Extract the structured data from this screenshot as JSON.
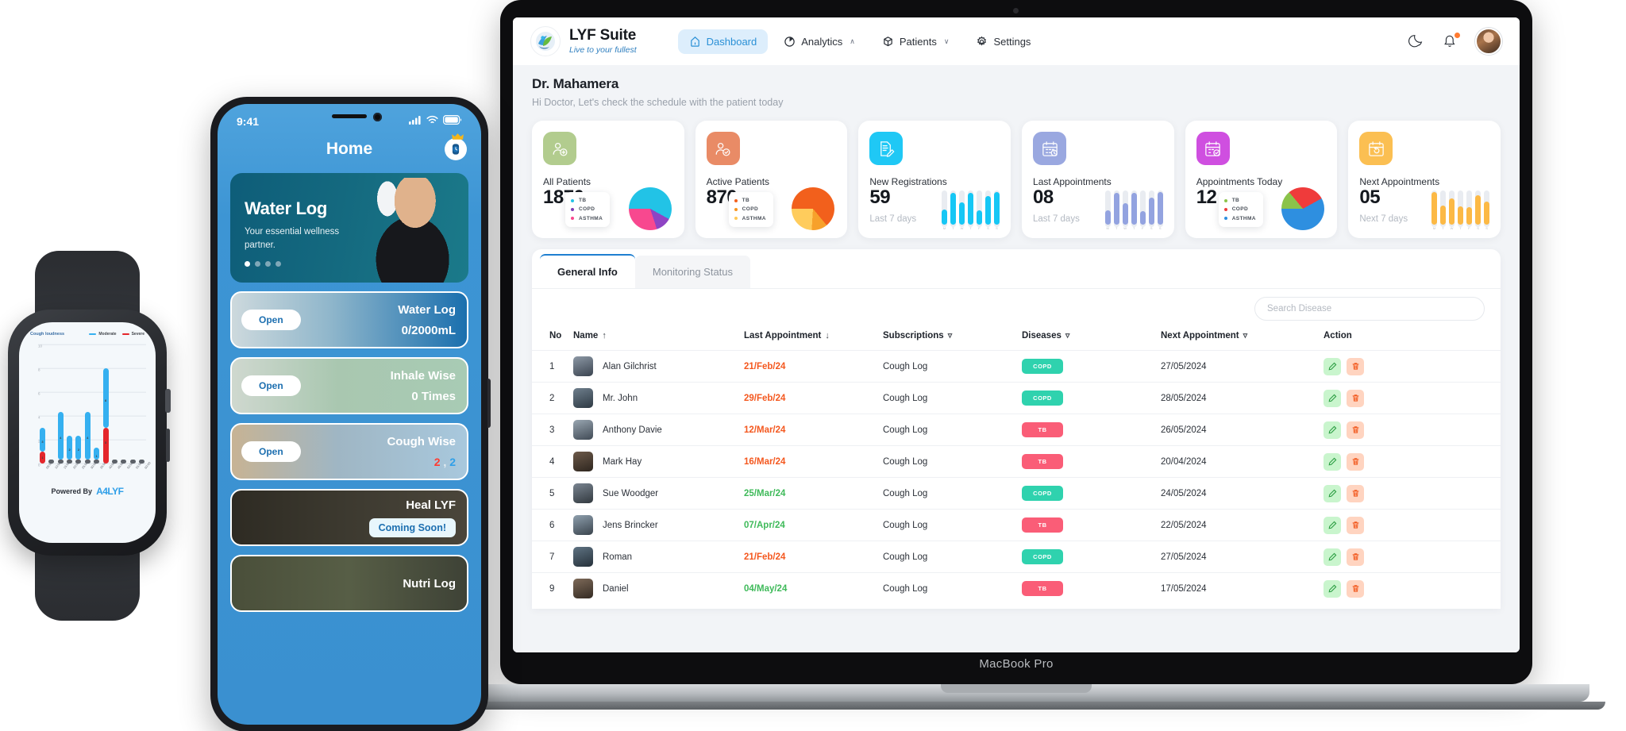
{
  "macbook": {
    "label": "MacBook Pro"
  },
  "dashboard": {
    "brand": {
      "title": "LYF Suite",
      "tagline": "Live to your fullest",
      "logo_icon": "lyf-heart-leaf-logo"
    },
    "nav": [
      {
        "label": "Dashboard",
        "icon": "home-icon",
        "active": true,
        "chevron": ""
      },
      {
        "label": "Analytics",
        "icon": "pie-chart-icon",
        "active": false,
        "chevron": "∧"
      },
      {
        "label": "Patients",
        "icon": "box-icon",
        "active": false,
        "chevron": "∨"
      },
      {
        "label": "Settings",
        "icon": "gear-icon",
        "active": false,
        "chevron": ""
      }
    ],
    "topright": {
      "theme_icon": "moon-icon",
      "notifications_icon": "bell-icon",
      "avatar_icon": "user-avatar"
    },
    "greeting": {
      "name": "Dr. Mahamera",
      "subtitle": "Hi Doctor, Let's check the schedule with the patient today"
    },
    "cards": [
      {
        "title": "All Patients",
        "value": "1870",
        "sub": "",
        "icon": "patient-add-icon",
        "icon_bg": "#b2cc8e",
        "chart": "pie",
        "legend": [
          {
            "label": "TB",
            "color": "#22c3e6"
          },
          {
            "label": "COPD",
            "color": "#7c3fb5"
          },
          {
            "label": "ASTHMA",
            "color": "#f8488f"
          }
        ],
        "pie_slices": [
          {
            "label": "TB",
            "value": 58,
            "color": "#22c3e6"
          },
          {
            "label": "COPD",
            "value": 12,
            "color": "#8e44c4"
          },
          {
            "label": "ASTHMA",
            "value": 30,
            "color": "#f8488f"
          }
        ]
      },
      {
        "title": "Active Patients",
        "value": "870",
        "sub": "",
        "icon": "patient-check-icon",
        "icon_bg": "#e98b66",
        "chart": "pie",
        "legend": [
          {
            "label": "TB",
            "color": "#f2601c"
          },
          {
            "label": "COPD",
            "color": "#f7941e"
          },
          {
            "label": "ASTHMA",
            "color": "#ffc857"
          }
        ],
        "pie_slices": [
          {
            "label": "TB",
            "value": 64,
            "color": "#f2601c"
          },
          {
            "label": "COPD",
            "value": 12,
            "color": "#f7a12b"
          },
          {
            "label": "ASTHMA",
            "value": 24,
            "color": "#ffcc5c"
          }
        ]
      },
      {
        "title": "New Registrations",
        "value": "59",
        "sub": "Last 7 days",
        "icon": "document-edit-icon",
        "icon_bg": "#1fc8f5",
        "chart": "bars",
        "bar_color": "#16c7f5",
        "bars": {
          "days": [
            "M",
            "T",
            "W",
            "T",
            "F",
            "S",
            "S"
          ],
          "values": [
            42,
            88,
            60,
            86,
            40,
            78,
            90
          ]
        }
      },
      {
        "title": "Last Appointments",
        "value": "08",
        "sub": "Last 7 days",
        "icon": "calendar-clock-icon",
        "icon_bg": "#9aa8e0",
        "chart": "bars",
        "bar_color": "#93a3e0",
        "bars": {
          "days": [
            "M",
            "T",
            "W",
            "T",
            "F",
            "S",
            "S"
          ],
          "values": [
            40,
            86,
            58,
            88,
            38,
            74,
            90
          ]
        }
      },
      {
        "title": "Appointments Today",
        "value": "12",
        "sub": "",
        "icon": "calendar-check-icon",
        "icon_bg": "#cf4fe0",
        "chart": "pie",
        "legend": [
          {
            "label": "TB",
            "color": "#8bc34a"
          },
          {
            "label": "COPD",
            "color": "#ef3b3b"
          },
          {
            "label": "ASTHMA",
            "color": "#2e8fe0"
          }
        ],
        "pie_slices": [
          {
            "label": "TB",
            "value": 14,
            "color": "#8bc34a"
          },
          {
            "label": "COPD",
            "value": 28,
            "color": "#ef3b3b"
          },
          {
            "label": "ASTHMA",
            "value": 58,
            "color": "#2e8fe0"
          }
        ]
      },
      {
        "title": "Next Appointments",
        "value": "05",
        "sub": "Next 7 days",
        "icon": "calendar-next-icon",
        "icon_bg": "#fbbf52",
        "chart": "bars",
        "bar_color": "#fcb945",
        "bars": {
          "days": [
            "M",
            "T",
            "W",
            "T",
            "F",
            "S",
            "S"
          ],
          "values": [
            90,
            52,
            72,
            50,
            48,
            80,
            62
          ]
        }
      }
    ],
    "tabs": [
      {
        "label": "General Info",
        "active": true
      },
      {
        "label": "Monitoring Status",
        "active": false
      }
    ],
    "search": {
      "placeholder": "Search Disease",
      "value": ""
    },
    "table": {
      "columns": [
        {
          "label": "No",
          "sort": ""
        },
        {
          "label": "Name",
          "sort": "↑"
        },
        {
          "label": "Last Appointment",
          "sort": "↓"
        },
        {
          "label": "Subscriptions",
          "sort": "filter"
        },
        {
          "label": "Diseases",
          "sort": "filter"
        },
        {
          "label": "Next Appointment",
          "sort": "filter"
        },
        {
          "label": "Action",
          "sort": ""
        }
      ],
      "rows": [
        {
          "no": "1",
          "name": "Alan Gilchrist",
          "last": "21/Feb/24",
          "last_state": "overdue",
          "subs": "Cough Log",
          "disease": "COPD",
          "next": "27/05/2024"
        },
        {
          "no": "2",
          "name": "Mr. John",
          "last": "29/Feb/24",
          "last_state": "overdue",
          "subs": "Cough Log",
          "disease": "COPD",
          "next": "28/05/2024"
        },
        {
          "no": "3",
          "name": "Anthony Davie",
          "last": "12/Mar/24",
          "last_state": "overdue",
          "subs": "Cough Log",
          "disease": "TB",
          "next": "26/05/2024"
        },
        {
          "no": "4",
          "name": "Mark Hay",
          "last": "16/Mar/24",
          "last_state": "overdue",
          "subs": "Cough Log",
          "disease": "TB",
          "next": "20/04/2024"
        },
        {
          "no": "5",
          "name": "Sue Woodger",
          "last": "25/Mar/24",
          "last_state": "ok",
          "subs": "Cough Log",
          "disease": "COPD",
          "next": "24/05/2024"
        },
        {
          "no": "6",
          "name": "Jens Brincker",
          "last": "07/Apr/24",
          "last_state": "ok",
          "subs": "Cough Log",
          "disease": "TB",
          "next": "22/05/2024"
        },
        {
          "no": "7",
          "name": "Roman",
          "last": "21/Feb/24",
          "last_state": "overdue",
          "subs": "Cough Log",
          "disease": "COPD",
          "next": "27/05/2024"
        },
        {
          "no": "9",
          "name": "Daniel",
          "last": "04/May/24",
          "last_state": "ok",
          "subs": "Cough Log",
          "disease": "TB",
          "next": "17/05/2024"
        }
      ],
      "actions": {
        "edit_icon": "pencil-icon",
        "delete_icon": "trash-icon"
      }
    }
  },
  "phone": {
    "status": {
      "time": "9:41",
      "signal_icon": "cellular-signal-icon",
      "wifi_icon": "wifi-icon",
      "battery_icon": "battery-icon"
    },
    "header": {
      "title": "Home",
      "watch_icon": "smartwatch-premium-icon",
      "crown_icon": "crown-icon"
    },
    "hero": {
      "title": "Water Log",
      "subtitle": "Your essential wellness partner.",
      "dots": 4,
      "active_dot": 0
    },
    "tiles": [
      {
        "title": "Water Log",
        "value": "0/2000mL",
        "open_label": "Open",
        "style": "wl"
      },
      {
        "title": "Inhale Wise",
        "value": "0 Times",
        "open_label": "Open",
        "style": "iw"
      },
      {
        "title": "Cough Wise",
        "value": "2 , 2",
        "open_label": "Open",
        "style": "cw"
      },
      {
        "title": "Heal LYF",
        "badge": "Coming Soon!",
        "style": "hl"
      },
      {
        "title": "Nutri Log",
        "style": "nl"
      }
    ]
  },
  "watch": {
    "powered_by": "Powered By",
    "brand": "A4LYF",
    "chart_data": {
      "type": "bar",
      "title": "Cough loudness",
      "xlabel": "",
      "ylabel": "",
      "ylim": [
        0,
        10
      ],
      "yticks": [
        0,
        2,
        4,
        6,
        8,
        10
      ],
      "grid": true,
      "legend_position": "top-right",
      "categories": [
        "08:00",
        "10:00",
        "15:00",
        "20:00",
        "25:00",
        "30:00",
        "35:00",
        "40:00",
        "45:00",
        "50:00",
        "55:00",
        "60:00"
      ],
      "series": [
        {
          "name": "Moderate",
          "color": "#35b0f0",
          "values": [
            3,
            0,
            4,
            2,
            2,
            4,
            1,
            8,
            0,
            0,
            0,
            0
          ]
        },
        {
          "name": "Severe",
          "color": "#e4262b",
          "values": [
            1,
            0,
            0,
            0,
            0,
            0,
            0,
            3,
            0,
            0,
            0,
            0
          ]
        }
      ]
    }
  }
}
